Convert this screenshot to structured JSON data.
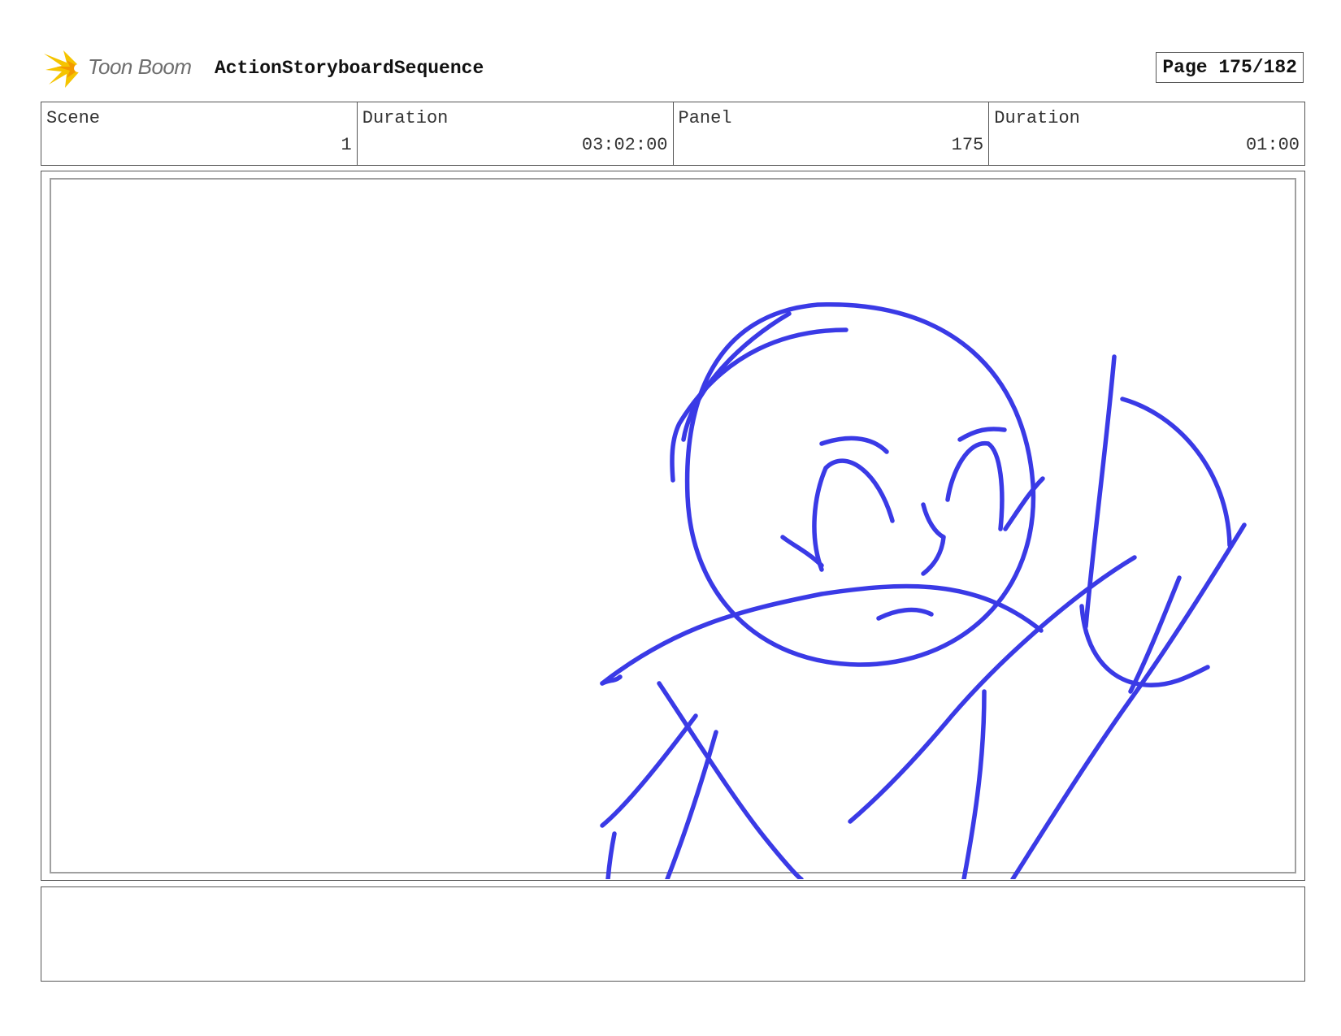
{
  "header": {
    "logo_text": "Toon Boom",
    "sequence_title": "ActionStoryboardSequence",
    "page_label": "Page 175/182"
  },
  "info": {
    "scene_label": "Scene",
    "scene_value": "1",
    "scene_duration_label": "Duration",
    "scene_duration_value": "03:02:00",
    "panel_label": "Panel",
    "panel_value": "175",
    "panel_duration_label": "Duration",
    "panel_duration_value": "01:00"
  },
  "colors": {
    "sketch_stroke": "#3a3ae6",
    "logo_yellow": "#f5c400",
    "logo_orange": "#f39a00"
  },
  "icons": {
    "logo": "toon-boom-starburst-icon"
  }
}
